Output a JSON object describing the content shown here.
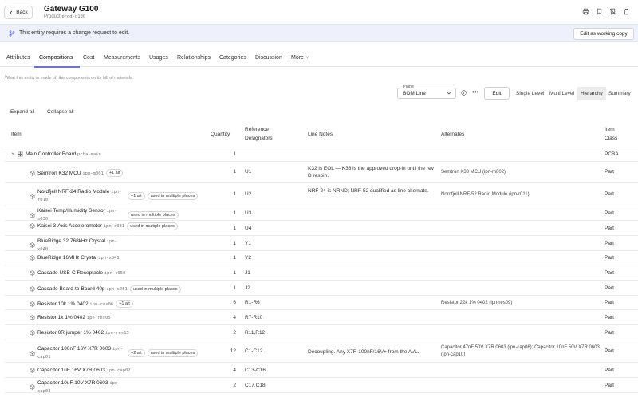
{
  "header": {
    "back_label": "Back",
    "title": "Gateway G100",
    "subtitle_prefix": "Product",
    "subtitle_code": "prod-g100",
    "icons": [
      "printer-icon",
      "bookmark-icon",
      "bookmark-off-icon",
      "trash-icon"
    ]
  },
  "banner": {
    "text": "This entity requires a change request to edit.",
    "button": "Edit as working copy"
  },
  "tabs": [
    "Attributes",
    "Compositions",
    "Cost",
    "Measurements",
    "Usages",
    "Relationships",
    "Categories",
    "Discussion",
    "More"
  ],
  "active_tab": "Compositions",
  "description": "What this entity is made of, the components on its bill of materials.",
  "toolbar": {
    "plane_label": "Plane",
    "plane_value": "BOM Line",
    "edit": "Edit",
    "views": [
      "Single Level",
      "Multi Level",
      "Hierarchy",
      "Summary"
    ],
    "active_view": "Hierarchy"
  },
  "actions": {
    "expand_all": "Expand all",
    "collapse_all": "Collapse all"
  },
  "columns": {
    "item": "Item",
    "quantity": "Quantity",
    "ref1": "Reference",
    "ref2": "Designators",
    "notes": "Line Notes",
    "alternates": "Alternates",
    "class1": "Item",
    "class2": "Class"
  },
  "rows": [
    {
      "name": "Main Controller Board",
      "pn": "pcba-main",
      "chips": [],
      "qty": "1",
      "ref": "",
      "notes": "",
      "alts": "",
      "cls": "PCBA",
      "level": 0
    },
    {
      "name": "Semtron K32 MCU",
      "pn": "ipn-m001",
      "chips": [
        "+1 alt"
      ],
      "qty": "1",
      "ref": "U1",
      "notes": "K32 is EOL — K33 is the approved drop-in until the rev D respin.",
      "alts": "Semtron K33 MCU (ipn-m002)",
      "cls": "Part",
      "level": 1
    },
    {
      "name": "Nordfjell NRF-24 Radio Module",
      "pn": "ipn-r010",
      "chips": [
        "+1 alt",
        "used in multiple places"
      ],
      "qty": "1",
      "ref": "U2",
      "notes": "NRF-24 is NRND; NRF-52 qualified as line alternate.",
      "alts": "Nordfjell NRF-52 Radio Module (ipn-r011)",
      "cls": "Part",
      "level": 1
    },
    {
      "name": "Kaisei Temp/Humidity Sensor",
      "pn": "ipn-s030",
      "chips": [
        "used in multiple places"
      ],
      "qty": "1",
      "ref": "U3",
      "notes": "",
      "alts": "",
      "cls": "Part",
      "level": 1
    },
    {
      "name": "Kaisei 3-Axis Accelerometer",
      "pn": "ipn-s031",
      "chips": [
        "used in multiple places"
      ],
      "qty": "1",
      "ref": "U4",
      "notes": "",
      "alts": "",
      "cls": "Part",
      "level": 1
    },
    {
      "name": "BlueRidge 32.768kHz Crystal",
      "pn": "ipn-x040",
      "chips": [],
      "qty": "1",
      "ref": "Y1",
      "notes": "",
      "alts": "",
      "cls": "Part",
      "level": 1
    },
    {
      "name": "BlueRidge 16MHz Crystal",
      "pn": "ipn-x041",
      "chips": [],
      "qty": "1",
      "ref": "Y2",
      "notes": "",
      "alts": "",
      "cls": "Part",
      "level": 1
    },
    {
      "name": "Cascade USB-C Receptacle",
      "pn": "ipn-c050",
      "chips": [],
      "qty": "1",
      "ref": "J1",
      "notes": "",
      "alts": "",
      "cls": "Part",
      "level": 1
    },
    {
      "name": "Cascade Board-to-Board 40p",
      "pn": "ipn-c051",
      "chips": [
        "used in multiple places"
      ],
      "qty": "1",
      "ref": "J2",
      "notes": "",
      "alts": "",
      "cls": "Part",
      "level": 1
    },
    {
      "name": "Resistor 10k 1% 0402",
      "pn": "ipn-res06",
      "chips": [
        "+1 alt"
      ],
      "qty": "6",
      "ref": "R1-R6",
      "notes": "",
      "alts": "Resistor 22k 1% 0402 (ipn-res09)",
      "cls": "Part",
      "level": 1
    },
    {
      "name": "Resistor 1k 1% 0402",
      "pn": "ipn-res05",
      "chips": [],
      "qty": "4",
      "ref": "R7-R10",
      "notes": "",
      "alts": "",
      "cls": "Part",
      "level": 1
    },
    {
      "name": "Resistor 0R jumper 1% 0402",
      "pn": "ipn-res15",
      "chips": [],
      "qty": "2",
      "ref": "R11,R12",
      "notes": "",
      "alts": "",
      "cls": "Part",
      "level": 1
    },
    {
      "name": "Capacitor 100nF 16V X7R 0603",
      "pn": "ipn-cap01",
      "chips": [
        "+2 alt",
        "used in multiple places"
      ],
      "qty": "12",
      "ref": "C1-C12",
      "notes": "Decoupling. Any X7R 100nF/16V+ from the AVL.",
      "alts": "Capacitor 47nF 50V X7R 0603 (ipn-cap06); Capacitor 10nF 50V X7R 0603 (ipn-cap10)",
      "cls": "Part",
      "level": 1
    },
    {
      "name": "Capacitor 1uF 16V X7R 0603",
      "pn": "ipn-cap02",
      "chips": [],
      "qty": "4",
      "ref": "C13-C16",
      "notes": "",
      "alts": "",
      "cls": "Part",
      "level": 1
    },
    {
      "name": "Capacitor 10uF 10V X7R 0603",
      "pn": "ipn-cap03",
      "chips": [],
      "qty": "2",
      "ref": "C17,C18",
      "notes": "",
      "alts": "",
      "cls": "Part",
      "level": 1
    }
  ]
}
